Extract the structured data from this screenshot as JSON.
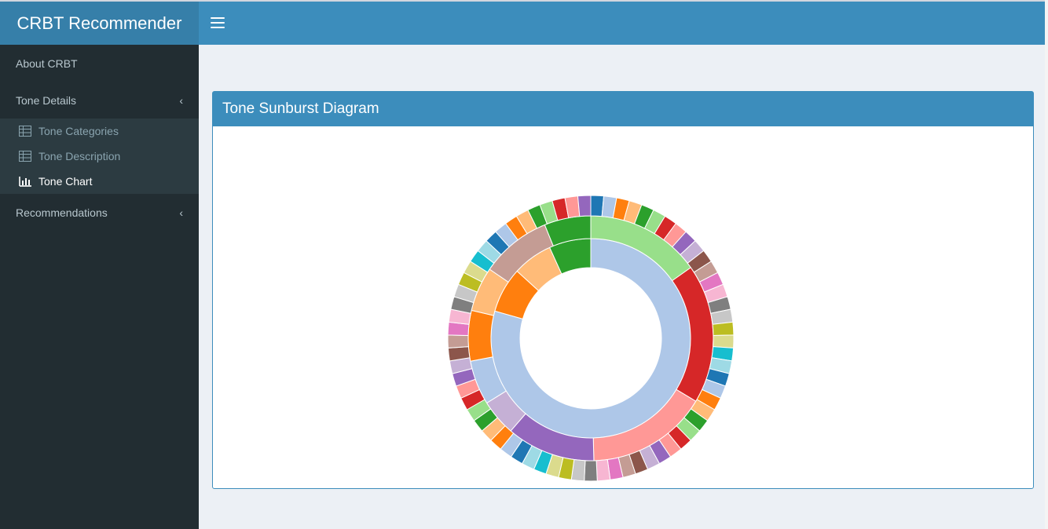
{
  "app": {
    "title": "CRBT Recommender"
  },
  "sidebar": {
    "items": [
      {
        "label": "About CRBT"
      },
      {
        "label": "Tone Details",
        "expanded": true,
        "children": [
          {
            "label": "Tone Categories",
            "icon": "table-icon"
          },
          {
            "label": "Tone Description",
            "icon": "table-icon"
          },
          {
            "label": "Tone Chart",
            "icon": "bar-chart-icon",
            "active": true
          }
        ]
      },
      {
        "label": "Recommendations"
      }
    ]
  },
  "panel": {
    "title": "Tone Sunburst Diagram"
  },
  "chart_data": {
    "type": "sunburst",
    "rings": [
      {
        "level": 1,
        "segments": [
          {
            "value": 270,
            "color": "#aec7e8"
          },
          {
            "value": 25,
            "color": "#ff7f0e"
          },
          {
            "value": 22,
            "color": "#ffbb78"
          },
          {
            "value": 23,
            "color": "#2ca02c"
          }
        ]
      },
      {
        "level": 2,
        "segments": [
          {
            "value": 57,
            "color": "#98df8a"
          },
          {
            "value": 69,
            "color": "#d62728"
          },
          {
            "value": 60,
            "color": "#ff9896"
          },
          {
            "value": 44,
            "color": "#9467bd"
          },
          {
            "value": 18,
            "color": "#c5b0d5"
          },
          {
            "value": 22,
            "color": "#aec7e8"
          },
          {
            "value": 25,
            "color": "#ff7f0e"
          },
          {
            "value": 22,
            "color": "#ffbb78"
          },
          {
            "value": 35,
            "color": "#c49c94"
          },
          {
            "value": 23,
            "color": "#2ca02c"
          }
        ]
      },
      {
        "level": 3,
        "segments_each": 5.2,
        "palette": [
          "#1f77b4",
          "#aec7e8",
          "#ff7f0e",
          "#ffbb78",
          "#2ca02c",
          "#98df8a",
          "#d62728",
          "#ff9896",
          "#9467bd",
          "#c5b0d5",
          "#8c564b",
          "#c49c94",
          "#e377c2",
          "#f7b6d2",
          "#7f7f7f",
          "#c7c7c7",
          "#bcbd22",
          "#dbdb8d",
          "#17becf",
          "#9edae5"
        ]
      }
    ]
  }
}
